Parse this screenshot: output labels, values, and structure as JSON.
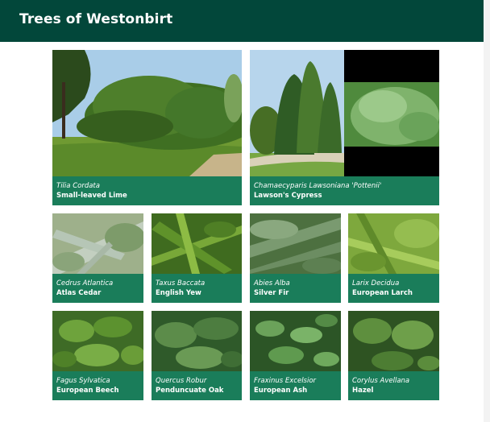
{
  "header": {
    "title": "Trees of Westonbirt"
  },
  "colors": {
    "header": "#02473a",
    "caption": "#1a7d5a"
  },
  "trees": [
    {
      "latin": "Tilia Cordata",
      "common": "Small-leaved Lime"
    },
    {
      "latin": "Chamaecyparis Lawsoniana 'Pottenii'",
      "common": "Lawson's Cypress"
    },
    {
      "latin": "Cedrus Atlantica",
      "common": "Atlas Cedar"
    },
    {
      "latin": "Taxus Baccata",
      "common": "English Yew"
    },
    {
      "latin": "Abies Alba",
      "common": "Silver Fir"
    },
    {
      "latin": "Larix Decidua",
      "common": "European Larch"
    },
    {
      "latin": "Fagus Sylvatica",
      "common": "European Beech"
    },
    {
      "latin": "Quercus Robur",
      "common": "Penduncuate Oak"
    },
    {
      "latin": "Fraxinus Excelsior",
      "common": "European Ash"
    },
    {
      "latin": "Corylus Avellana",
      "common": "Hazel"
    }
  ]
}
